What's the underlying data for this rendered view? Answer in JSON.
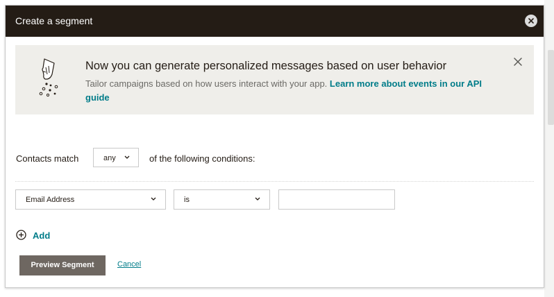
{
  "modal": {
    "title": "Create a segment",
    "close_icon": "close-circle-icon"
  },
  "banner": {
    "title": "Now you can generate personalized messages based on user behavior",
    "body": "Tailor campaigns based on how users interact with your app. ",
    "link": "Learn more about events in our API guide",
    "illustration": "hand-scattering-dots-illustration",
    "close_icon": "close-icon"
  },
  "match": {
    "prefix": "Contacts match",
    "selected": "any",
    "suffix": "of the following conditions:"
  },
  "condition": {
    "field": "Email Address",
    "operator": "is",
    "value": ""
  },
  "actions": {
    "add_label": "Add",
    "preview_label": "Preview Segment",
    "cancel_label": "Cancel"
  },
  "colors": {
    "header_bg": "#241c15",
    "banner_bg": "#efeeea",
    "link": "#007c89",
    "primary_button": "#6e6761"
  }
}
